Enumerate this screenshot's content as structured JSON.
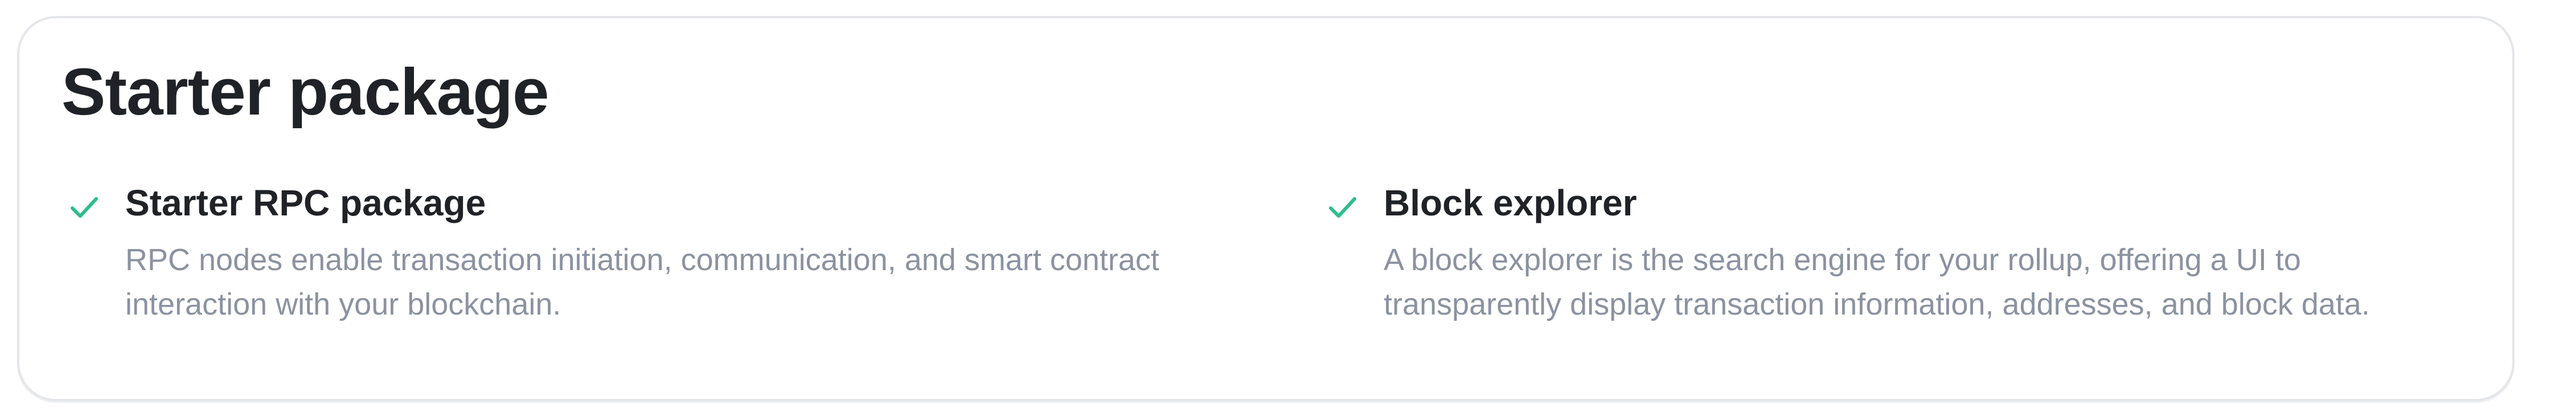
{
  "card": {
    "title": "Starter package",
    "features": [
      {
        "title": "Starter RPC package",
        "description_line1": "RPC nodes enable transaction initiation, communication, and smart contract",
        "description_line2": "interaction with your blockchain.",
        "icon": "check-icon"
      },
      {
        "title": "Block explorer",
        "description_line1": "A block explorer is the search engine for your rollup, offering a UI to",
        "description_line2": "transparently display transaction information, addresses, and block data.",
        "icon": "check-icon"
      }
    ]
  },
  "colors": {
    "check": "#2dbd8b",
    "title": "#1f2226",
    "description": "#8b92a0",
    "border": "#e4e6ea"
  }
}
